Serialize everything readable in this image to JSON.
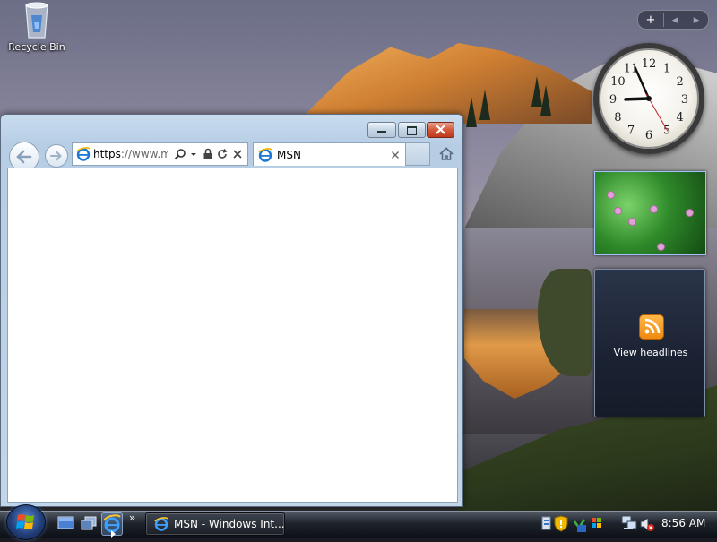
{
  "desktop": {
    "icons": [
      {
        "label": "Recycle Bin"
      }
    ]
  },
  "sidebar": {
    "controls": {
      "add": "+",
      "prev": "◂",
      "next": "▸"
    },
    "clock": {
      "numbers": [
        "12",
        "1",
        "2",
        "3",
        "4",
        "5",
        "6",
        "7",
        "8",
        "9",
        "10",
        "11"
      ],
      "time": "8:56"
    },
    "feed": {
      "label": "View headlines"
    }
  },
  "browser": {
    "address": {
      "scheme": "https",
      "rest": "://www.m..."
    },
    "tab": {
      "title": "MSN"
    },
    "colors": {
      "frame": "#c2d6ea",
      "close": "#c0381c"
    }
  },
  "taskbar": {
    "task": {
      "title": "MSN - Windows Int..."
    },
    "tray": {
      "time": "8:56 AM"
    },
    "overflow": "»"
  }
}
